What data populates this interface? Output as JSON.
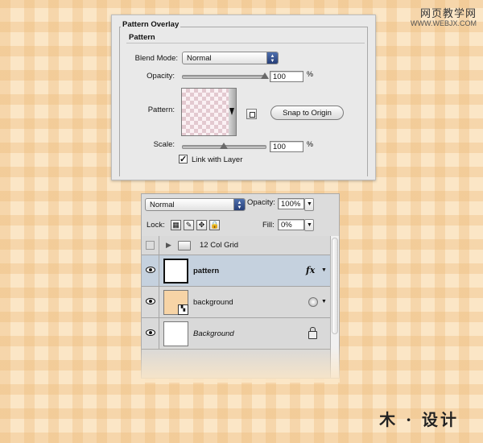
{
  "watermark": {
    "top_cn": "网页教学网",
    "top_url": "WWW.WEBJX.COM",
    "bottom": "木 · 设计"
  },
  "pattern_overlay": {
    "title": "Pattern Overlay",
    "group_label": "Pattern",
    "blend_mode_label": "Blend Mode:",
    "blend_mode_value": "Normal",
    "opacity_label": "Opacity:",
    "opacity_value": "100",
    "opacity_unit": "%",
    "opacity_level": 100,
    "pattern_label": "Pattern:",
    "snap_button": "Snap to Origin",
    "scale_label": "Scale:",
    "scale_value": "100",
    "scale_unit": "%",
    "scale_level": 50,
    "link_label": "Link with Layer",
    "link_checked": true
  },
  "layers_panel": {
    "blend_mode": "Normal",
    "opacity_label": "Opacity:",
    "opacity_value": "100%",
    "lock_label": "Lock:",
    "fill_label": "Fill:",
    "fill_value": "0%",
    "layers": [
      {
        "name": "12 Col Grid",
        "kind": "group"
      },
      {
        "name": "pattern",
        "kind": "layer",
        "selected": true,
        "fx": "fx"
      },
      {
        "name": "background",
        "kind": "layer"
      },
      {
        "name": "Background",
        "kind": "background",
        "italic": true
      }
    ]
  },
  "colors": {
    "canvas_bg": "#fbe6c6",
    "plaid": "#ecb876",
    "selected_row": "#c5d1de",
    "bg_thumb": "#f7d4a6"
  }
}
